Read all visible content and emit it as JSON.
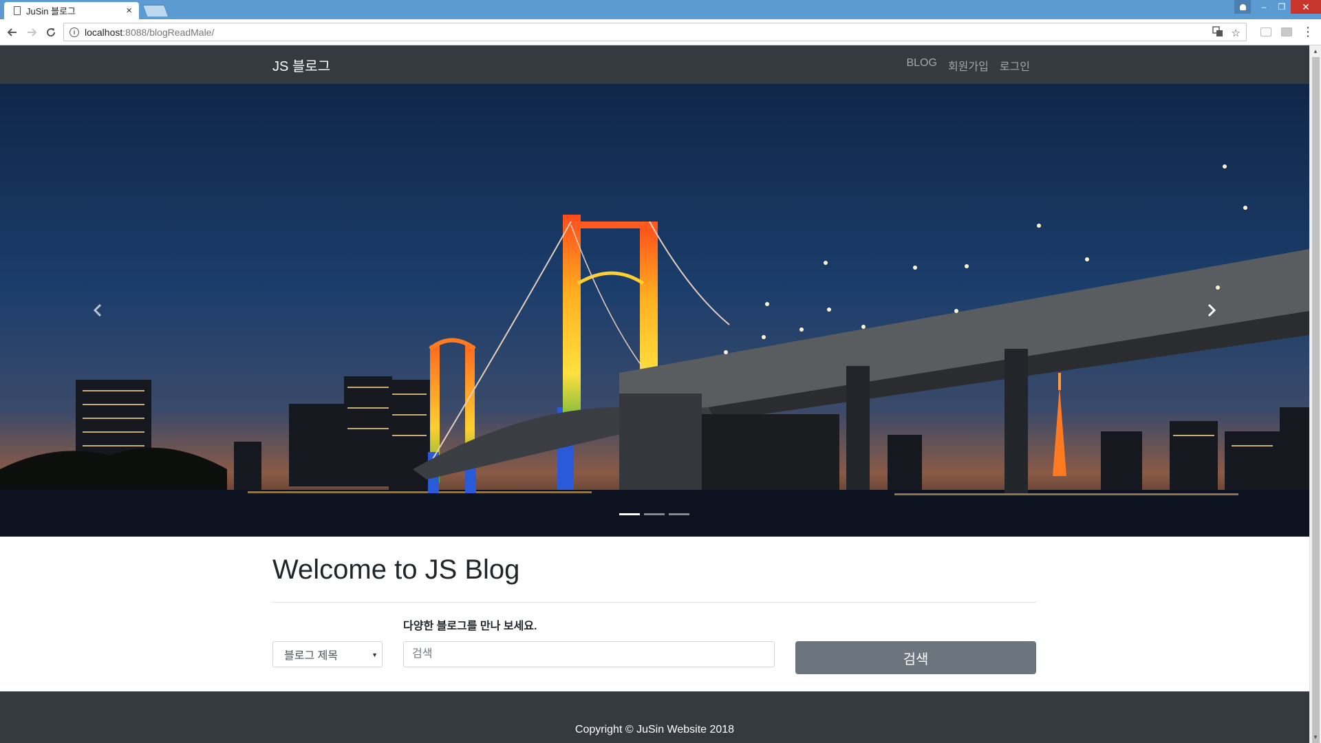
{
  "browser": {
    "tab_title": "JuSin 블로그",
    "tab_close": "×",
    "url_host": "localhost",
    "url_rest": ":8088/blogReadMale/",
    "window_controls": {
      "minimize": "–",
      "restore": "❐",
      "close": "✕"
    }
  },
  "navbar": {
    "brand": "JS 블로그",
    "links": [
      "BLOG",
      "회원가입",
      "로그인"
    ]
  },
  "carousel": {
    "slide_count": 3,
    "active_index": 0
  },
  "main": {
    "heading": "Welcome to JS Blog",
    "subtext": "다양한 블로그를 만나 보세요.",
    "search_select_value": "블로그 제목",
    "search_placeholder": "검색",
    "search_button": "검색"
  },
  "footer": {
    "copyright": "Copyright © JuSin Website 2018"
  },
  "colors": {
    "navbar_bg": "#343a40",
    "footer_bg": "#343a40",
    "button_bg": "#6c757d",
    "tabstrip_bg": "#5b9bd1"
  }
}
